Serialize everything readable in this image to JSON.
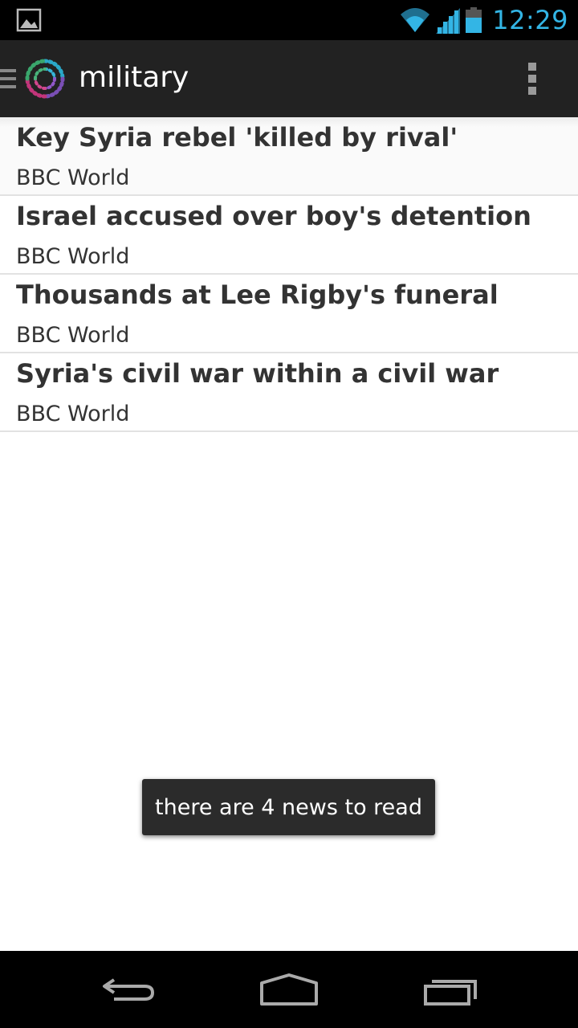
{
  "status_bar": {
    "time": "12:29",
    "accent_color": "#33b5e5",
    "icons": [
      "image-notification-icon",
      "wifi-icon",
      "signal-icon",
      "battery-icon"
    ]
  },
  "action_bar": {
    "title": "military",
    "icons": [
      "drawer-indicator-icon",
      "app-logo-icon",
      "overflow-menu-icon"
    ]
  },
  "news": [
    {
      "title": "Key Syria rebel 'killed by rival'",
      "source": "BBC World"
    },
    {
      "title": "Israel accused over boy's detention",
      "source": "BBC World"
    },
    {
      "title": "Thousands at Lee Rigby's funeral",
      "source": "BBC World"
    },
    {
      "title": "Syria's civil war within a civil war",
      "source": "BBC World"
    }
  ],
  "toast": {
    "message": "there are 4 news to read"
  },
  "nav_bar": {
    "icons": [
      "back-icon",
      "home-icon",
      "recent-apps-icon"
    ]
  }
}
